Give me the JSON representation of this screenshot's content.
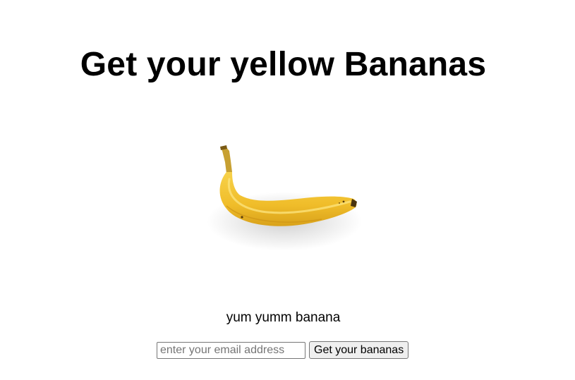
{
  "header": {
    "title": "Get your yellow Bananas"
  },
  "hero": {
    "image": "banana-image"
  },
  "main": {
    "caption": "yum yumm banana"
  },
  "signup": {
    "email_placeholder": "enter your email address",
    "email_value": "",
    "submit_label": "Get your bananas"
  },
  "colors": {
    "background": "#ffffff",
    "text": "#000000",
    "banana_yellow": "#f2c230",
    "banana_shadow": "#d9a21b",
    "banana_stem": "#c7a032",
    "button_bg": "#efefef",
    "border": "#767676"
  }
}
